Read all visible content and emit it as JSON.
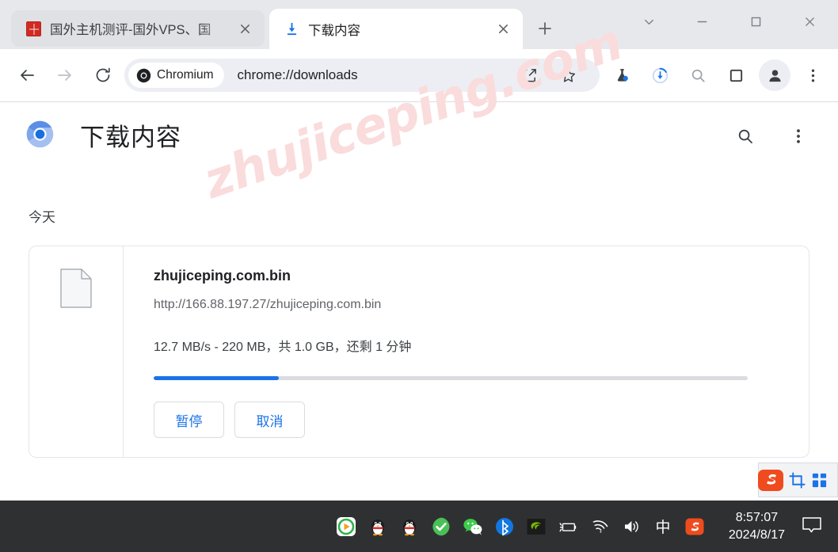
{
  "window": {
    "controls": {
      "tab_search": "chevron-down-icon",
      "minimize": "minimize-icon",
      "maximize": "maximize-icon",
      "close": "close-icon"
    }
  },
  "tabs": [
    {
      "title": "国外主机测评-国外VPS、国",
      "favicon": "cn-site-favicon",
      "active": false,
      "close": "×"
    },
    {
      "title": "下载内容",
      "favicon": "download-icon",
      "active": true,
      "close": "×"
    }
  ],
  "newtab": {
    "label": "+",
    "name": "new-tab-button"
  },
  "toolbar": {
    "back": "back-arrow-icon",
    "forward": "forward-arrow-icon",
    "reload": "reload-icon",
    "omnibox": {
      "chip_label": "Chromium",
      "url": "chrome://downloads"
    },
    "icons": [
      "share-icon",
      "bookmark-star-icon",
      "flask-icon",
      "download-progress-icon",
      "search-icon",
      "side-panel-icon",
      "profile-avatar-icon",
      "more-vertical-icon"
    ]
  },
  "downloads_page": {
    "title": "下载内容",
    "search_icon": "search-icon",
    "more_icon": "more-vertical-icon",
    "section_label": "今天",
    "watermark": "zhujiceping.com",
    "item": {
      "filename": "zhujiceping.com.bin",
      "url": "http://166.88.197.27/zhujiceping.com.bin",
      "status": "12.7 MB/s - 220 MB，共 1.0 GB，还剩 1 分钟",
      "progress_percent": 21,
      "file_icon": "generic-file-icon",
      "buttons": {
        "pause": "暂停",
        "cancel": "取消"
      }
    }
  },
  "sogou_widget": {
    "logo": "sogou-s-logo-icon",
    "crop": "crop-icon",
    "grid": "grid-icon"
  },
  "taskbar": {
    "tray_icons": [
      "media-player-icon",
      "qq-penguin-icon",
      "qq-penguin-icon",
      "green-check-icon",
      "wechat-icon",
      "bluetooth-icon",
      "nvidia-icon",
      "battery-charging-icon",
      "wifi-icon",
      "volume-icon",
      "ime-chinese-icon",
      "sogou-icon"
    ],
    "time": "8:57:07",
    "date": "2024/8/17",
    "notification_icon": "notification-bubble-icon"
  },
  "colors": {
    "accent": "#1a73e8",
    "tabstrip_bg": "#e7e8ec",
    "taskbar_bg": "#2f3032",
    "watermark": "#fadcdc"
  }
}
